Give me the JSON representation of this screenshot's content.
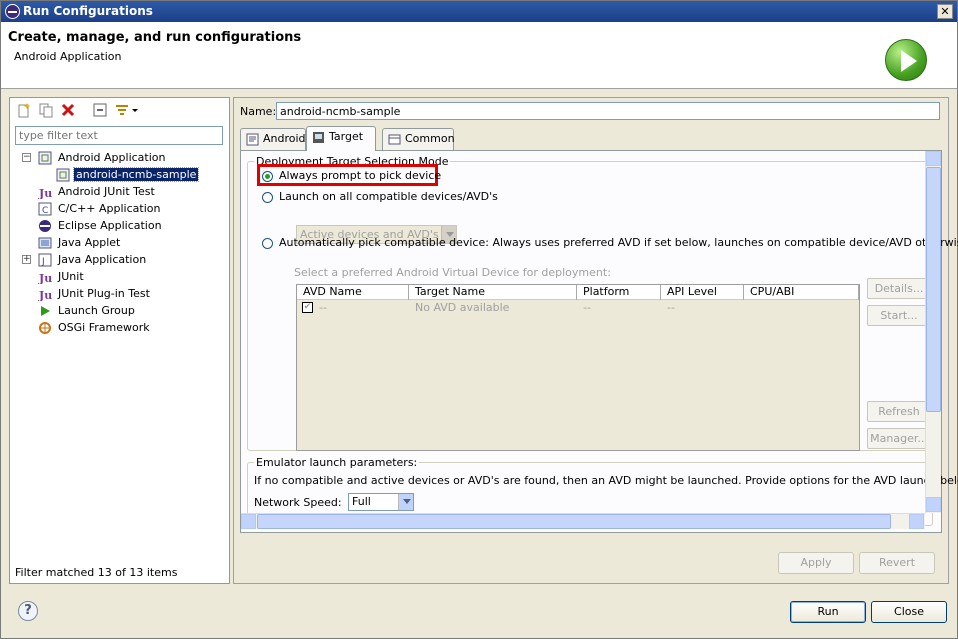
{
  "window": {
    "title": "Run Configurations",
    "close_glyph": "✕"
  },
  "header": {
    "title": "Create, manage, and run configurations",
    "subtitle": "Android Application"
  },
  "left": {
    "filter_placeholder": "type filter text",
    "tree": [
      {
        "label": "Android Application",
        "icon": "android-app-icon",
        "expanded": true
      },
      {
        "label": "android-ncmb-sample",
        "icon": "android-config-icon",
        "selected": true
      },
      {
        "label": "Android JUnit Test",
        "icon": "junit-icon"
      },
      {
        "label": "C/C++ Application",
        "icon": "c-app-icon"
      },
      {
        "label": "Eclipse Application",
        "icon": "eclipse-icon"
      },
      {
        "label": "Java Applet",
        "icon": "java-applet-icon"
      },
      {
        "label": "Java Application",
        "icon": "java-app-icon",
        "collapsed": true
      },
      {
        "label": "JUnit",
        "icon": "junit-icon"
      },
      {
        "label": "JUnit Plug-in Test",
        "icon": "junit-plugin-icon"
      },
      {
        "label": "Launch Group",
        "icon": "launch-group-icon"
      },
      {
        "label": "OSGi Framework",
        "icon": "osgi-icon"
      }
    ],
    "filter_status": "Filter matched 13 of 13 items"
  },
  "right": {
    "name_label": "Name:",
    "name_value": "android-ncmb-sample",
    "tabs": [
      {
        "label": "Android"
      },
      {
        "label": "Target",
        "active": true
      },
      {
        "label": "Common"
      }
    ],
    "deployment": {
      "title": "Deployment Target Selection Mode",
      "opt_prompt": "Always prompt to pick device",
      "opt_launch_all": "Launch on all compatible devices/AVD's",
      "launch_all_combo": "Active devices and AVD's",
      "opt_auto": "Automatically pick compatible device: Always uses preferred AVD if set below, launches on compatible device/AVD otherwise.",
      "avd_hint": "Select a preferred Android Virtual Device for deployment:",
      "columns": [
        "AVD Name",
        "Target Name",
        "Platform",
        "API Level",
        "CPU/ABI"
      ],
      "row": {
        "name": "--",
        "target": "No AVD available",
        "platform": "--",
        "api": "--"
      },
      "side_buttons": [
        "Details...",
        "Start...",
        "Refresh",
        "Manager..."
      ]
    },
    "emulator": {
      "title": "Emulator launch parameters:",
      "note": "If no compatible and active devices or AVD's are found, then an AVD might be launched. Provide options for the AVD launch below",
      "speed_label": "Network Speed:",
      "speed_value": "Full"
    },
    "apply_label": "Apply",
    "revert_label": "Revert"
  },
  "footer": {
    "run_label": "Run",
    "close_label": "Close",
    "help_glyph": "?"
  }
}
